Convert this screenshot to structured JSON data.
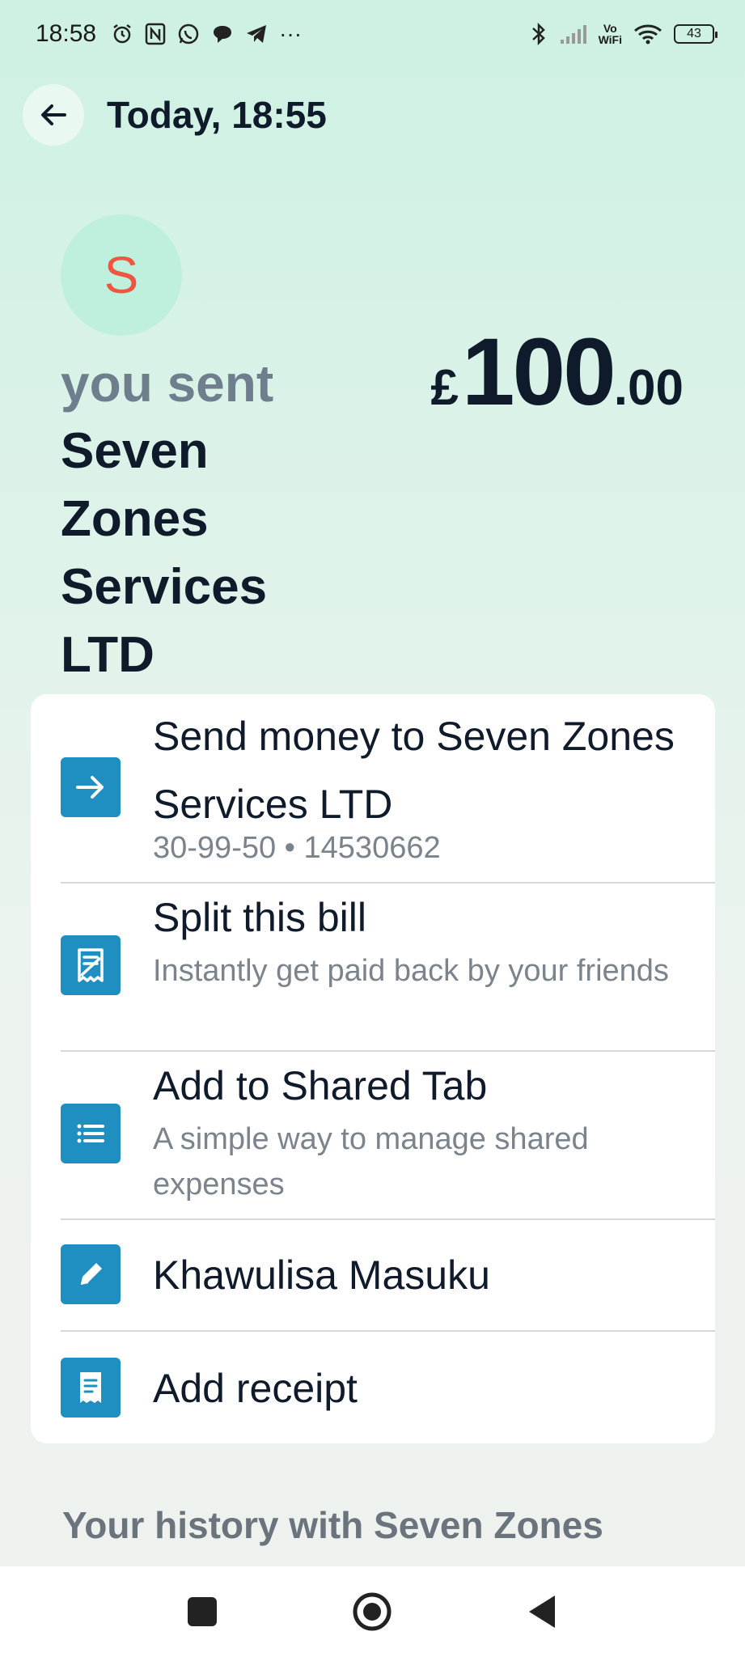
{
  "status_bar": {
    "time": "18:58",
    "left_icons": [
      "alarm-icon",
      "nfc-icon",
      "whatsapp-icon",
      "chat-icon",
      "telegram-icon",
      "more-icon"
    ],
    "more_glyph": "···",
    "vowifi_top": "Vo",
    "vowifi_bottom": "WiFi",
    "battery": "43"
  },
  "header": {
    "title": "Today, 18:55"
  },
  "transaction": {
    "avatar_letter": "S",
    "label": "you sent",
    "merchant": "Seven Zones Services LTD",
    "amount_currency": "£",
    "amount_major": "100",
    "amount_minor": ".00"
  },
  "actions": [
    {
      "icon": "arrow-right-icon",
      "title": "Send money to Seven Zones Services LTD",
      "subtitle": "30-99-50 • 14530662"
    },
    {
      "icon": "split-bill-icon",
      "title": "Split this bill",
      "subtitle": "Instantly get paid back by your friends"
    },
    {
      "icon": "list-icon",
      "title": "Add to Shared Tab",
      "subtitle": "A simple way to manage shared expenses"
    },
    {
      "icon": "pencil-icon",
      "title": "Khawulisa Masuku",
      "subtitle": ""
    },
    {
      "icon": "receipt-icon",
      "title": "Add receipt",
      "subtitle": ""
    }
  ],
  "history": {
    "title": "Your history with Seven Zones"
  },
  "colors": {
    "accent": "#1f8fc1",
    "avatar_bg": "#bff0de",
    "avatar_letter": "#ef5541",
    "text_primary": "#0f1b2a",
    "text_muted": "#6f7e8d"
  }
}
